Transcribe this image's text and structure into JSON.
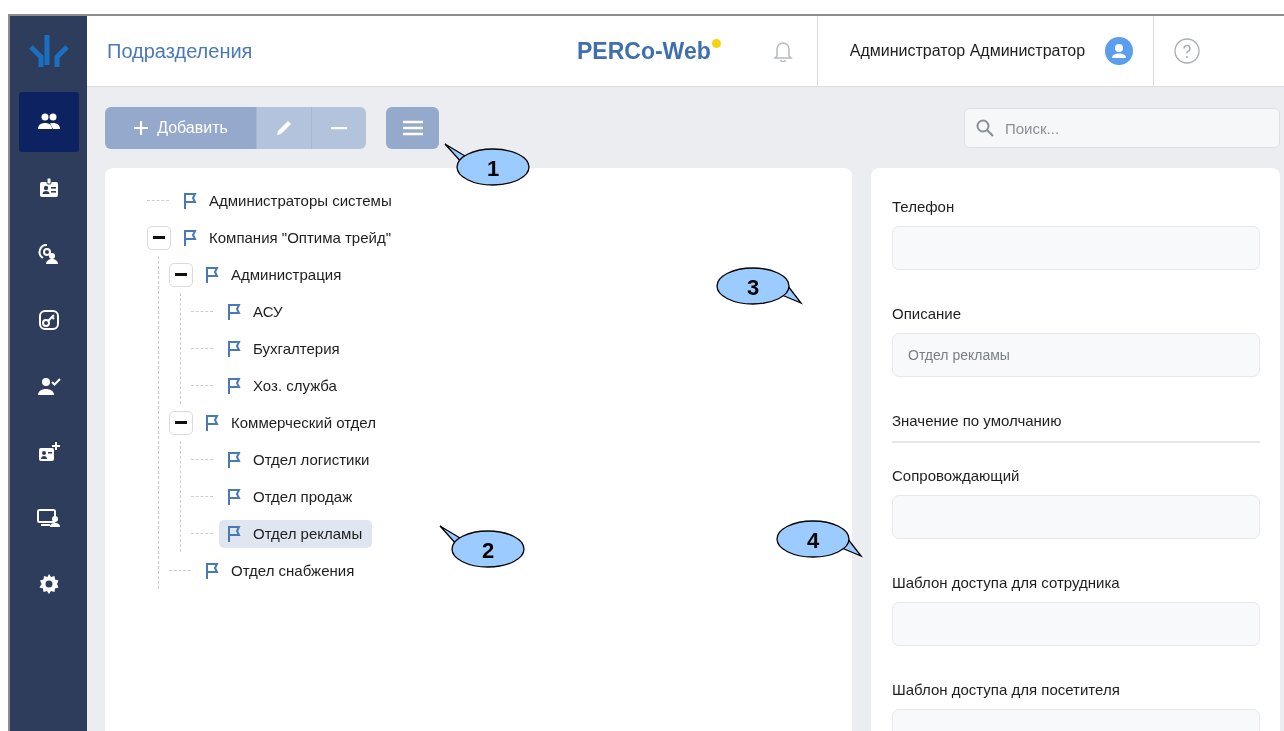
{
  "header": {
    "title": "Подразделения",
    "logo": "PERCo-Web",
    "user_name": "Администратор Администратор"
  },
  "sidebar": {
    "items": [
      {
        "selected": true
      },
      {
        "selected": false
      },
      {
        "selected": false
      },
      {
        "selected": false
      },
      {
        "selected": false
      },
      {
        "selected": false
      },
      {
        "selected": false
      },
      {
        "selected": false
      }
    ]
  },
  "toolbar": {
    "buttons": [
      {
        "kind": "add",
        "label": "Добавить",
        "disabled": false
      },
      {
        "kind": "edit",
        "disabled": true
      },
      {
        "kind": "remove",
        "disabled": true
      },
      {
        "kind": "menu",
        "disabled": false
      }
    ],
    "search": {
      "placeholder": "Поиск..."
    }
  },
  "tree": [
    {
      "label": "Администраторы системы",
      "selected": false
    },
    {
      "label": "Компания \"Оптима трейд\"",
      "selected": false,
      "expanded": true,
      "children": [
        {
          "label": "Администрация",
          "selected": false,
          "expanded": true,
          "children": [
            {
              "label": "АСУ",
              "selected": false
            },
            {
              "label": "Бухгалтерия",
              "selected": false
            },
            {
              "label": "Хоз. служба",
              "selected": false
            }
          ]
        },
        {
          "label": "Коммерческий отдел",
          "selected": false,
          "expanded": true,
          "children": [
            {
              "label": "Отдел логистики",
              "selected": false
            },
            {
              "label": "Отдел продаж",
              "selected": false
            },
            {
              "label": "Отдел рекламы",
              "selected": true
            }
          ]
        },
        {
          "label": "Отдел снабжения",
          "selected": false
        }
      ]
    }
  ],
  "form": [
    {
      "kind": "field",
      "label": "Телефон"
    },
    {
      "kind": "field",
      "label": "Описание",
      "value": "Отдел рекламы"
    },
    {
      "kind": "section",
      "label": "Значение по умолчанию"
    },
    {
      "kind": "field",
      "label": "Сопровождающий"
    },
    {
      "kind": "field",
      "label": "Шаблон доступа для сотрудника"
    },
    {
      "kind": "field",
      "label": "Шаблон доступа для посетителя"
    }
  ],
  "callouts": [
    {
      "number": "1"
    },
    {
      "number": "2"
    },
    {
      "number": "3"
    },
    {
      "number": "4"
    }
  ]
}
